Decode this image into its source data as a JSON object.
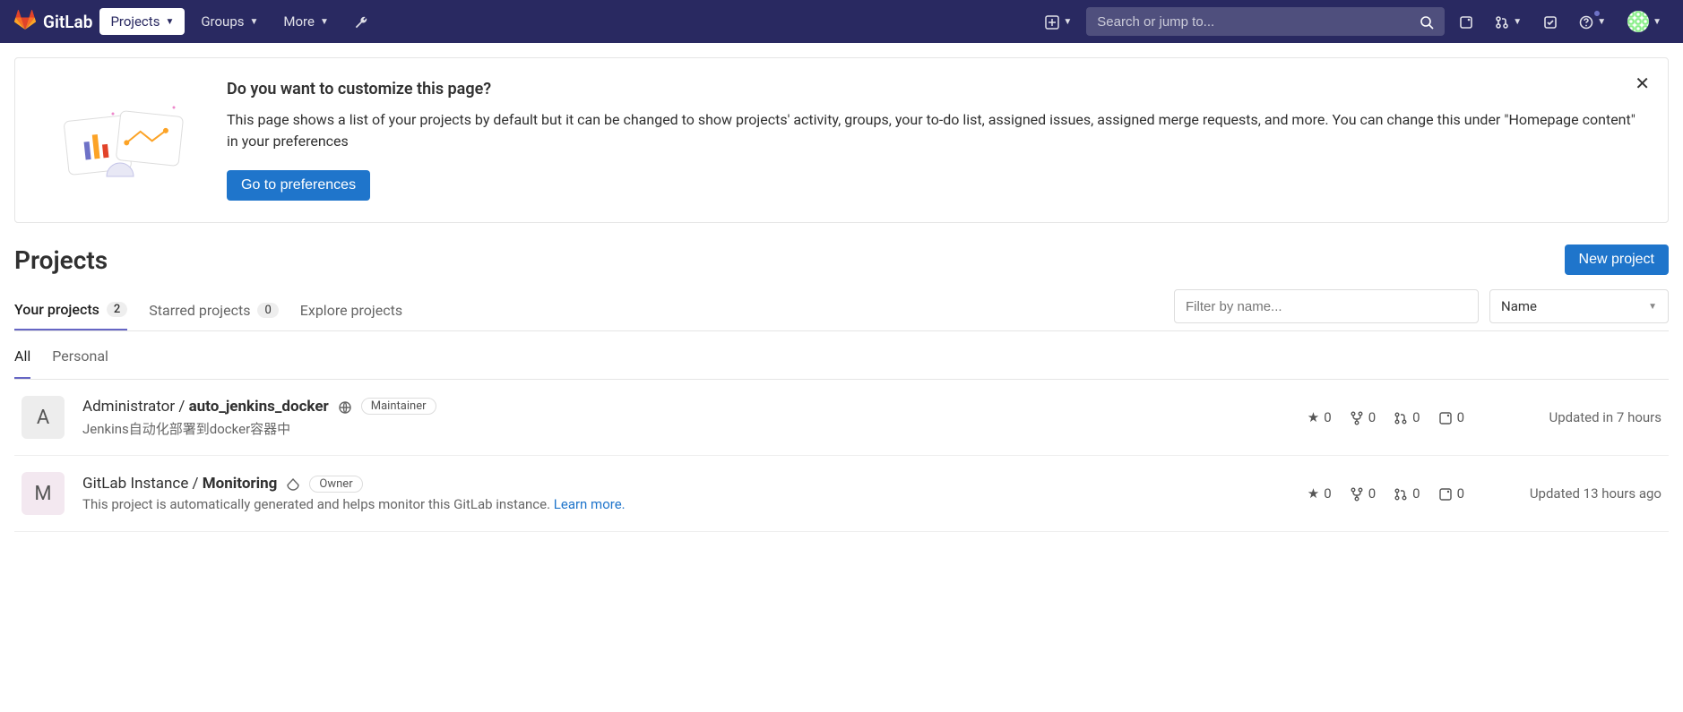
{
  "brand": "GitLab",
  "nav": {
    "projects": "Projects",
    "groups": "Groups",
    "more": "More"
  },
  "search": {
    "placeholder": "Search or jump to..."
  },
  "callout": {
    "title": "Do you want to customize this page?",
    "body": "This page shows a list of your projects by default but it can be changed to show projects' activity, groups, your to-do list, assigned issues, assigned merge requests, and more. You can change this under \"Homepage content\" in your preferences",
    "button": "Go to preferences"
  },
  "page_title": "Projects",
  "new_project_btn": "New project",
  "main_tabs": {
    "your": {
      "label": "Your projects",
      "count": "2"
    },
    "starred": {
      "label": "Starred projects",
      "count": "0"
    },
    "explore": {
      "label": "Explore projects"
    }
  },
  "filter": {
    "placeholder": "Filter by name..."
  },
  "sort": {
    "selected": "Name"
  },
  "scope_tabs": {
    "all": "All",
    "personal": "Personal"
  },
  "projects": [
    {
      "avatar_letter": "A",
      "avatar_class": "pa-A",
      "namespace": "Administrator / ",
      "name": "auto_jenkins_docker",
      "visibility": "public",
      "role": "Maintainer",
      "description": "Jenkins自动化部署到docker容器中",
      "learn_more": "",
      "stars": "0",
      "forks": "0",
      "mrs": "0",
      "issues": "0",
      "updated": "Updated in 7 hours"
    },
    {
      "avatar_letter": "M",
      "avatar_class": "pa-M",
      "namespace": "GitLab Instance / ",
      "name": "Monitoring",
      "visibility": "internal",
      "role": "Owner",
      "description": "This project is automatically generated and helps monitor this GitLab instance. ",
      "learn_more": "Learn more.",
      "stars": "0",
      "forks": "0",
      "mrs": "0",
      "issues": "0",
      "updated": "Updated 13 hours ago"
    }
  ]
}
